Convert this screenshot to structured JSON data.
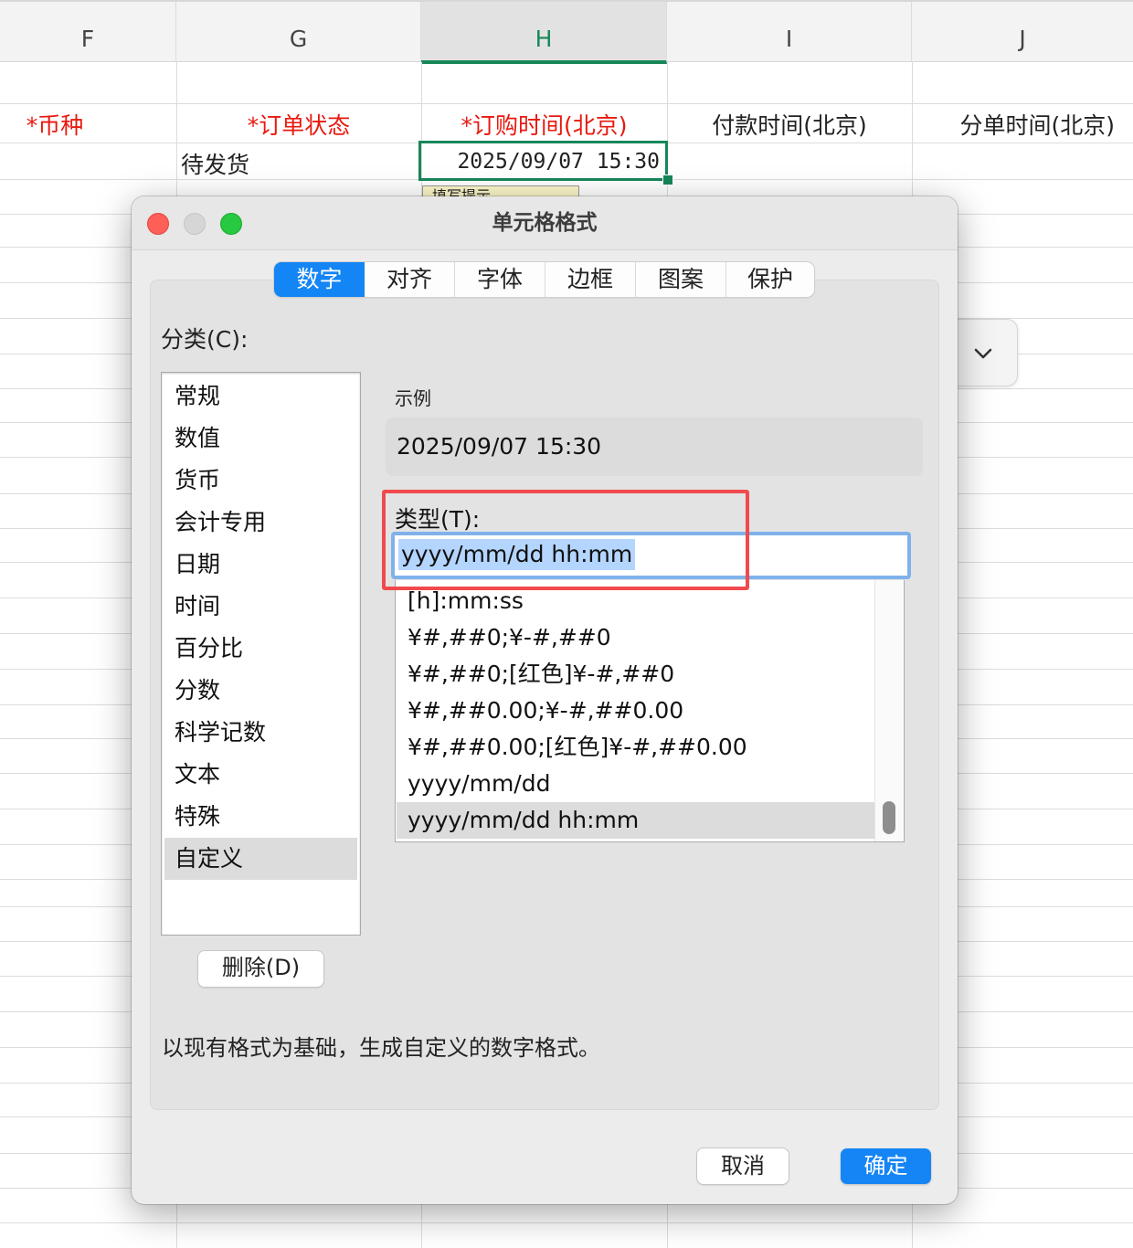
{
  "sheet": {
    "columns": [
      "F",
      "G",
      "H",
      "I",
      "J"
    ],
    "active_column": "H",
    "headers": {
      "f": "*币种",
      "g": "*订单状态",
      "h": "*订购时间(北京)",
      "i": "付款时间(北京)",
      "j": "分单时间(北京)"
    },
    "row_values": {
      "g": "待发货",
      "h": "2025/09/07 15:30"
    },
    "input_hint": "填写提示",
    "accent_color": "#17875a",
    "required_header_color": "#e8190f"
  },
  "dialog": {
    "title": "单元格格式",
    "tabs": [
      "数字",
      "对齐",
      "字体",
      "边框",
      "图案",
      "保护"
    ],
    "active_tab": "数字",
    "category_label": "分类(C):",
    "categories": [
      "常规",
      "数值",
      "货币",
      "会计专用",
      "日期",
      "时间",
      "百分比",
      "分数",
      "科学记数",
      "文本",
      "特殊",
      "自定义"
    ],
    "selected_category": "自定义",
    "delete_button": "删除(D)",
    "sample_label": "示例",
    "sample_value": "2025/09/07 15:30",
    "type_label": "类型(T):",
    "type_value": "yyyy/mm/dd hh:mm",
    "formats": [
      "[h]:mm:ss",
      "¥#,##0;¥-#,##0",
      "¥#,##0;[红色]¥-#,##0",
      "¥#,##0.00;¥-#,##0.00",
      "¥#,##0.00;[红色]¥-#,##0.00",
      "yyyy/mm/dd",
      "yyyy/mm/dd hh:mm"
    ],
    "selected_format": "yyyy/mm/dd hh:mm",
    "description": "以现有格式为基础，生成自定义的数字格式。",
    "cancel_button": "取消",
    "ok_button": "确定",
    "primary_color": "#1385f4",
    "highlight_color": "#f04a4d"
  }
}
